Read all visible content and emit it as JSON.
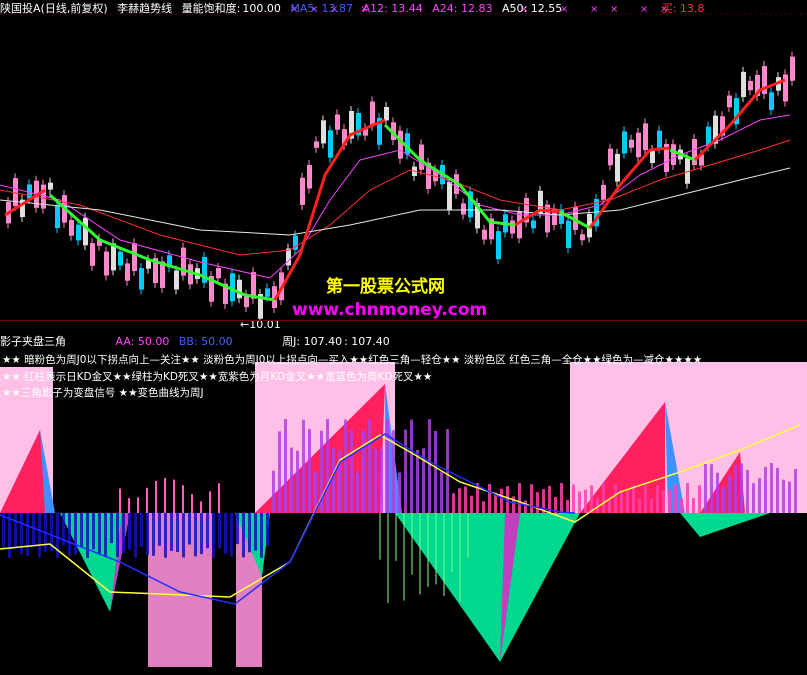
{
  "header1": {
    "stock": "陕国投A",
    "period": "(日线,前复权)",
    "indicator": "李赫趋势线",
    "param_label": "量能饱和度:",
    "param_value": "100.00",
    "ma5": "MA5: 13.87",
    "a12": "A12: 13.44",
    "a24": "A24: 12.83",
    "a50": "A50: 12.55",
    "buy": "买: 13.8"
  },
  "main_chart": {
    "low_marker": "10.01"
  },
  "watermark": {
    "title": "第一股票公式网",
    "url": "www.chnmoney.com"
  },
  "header2": {
    "name": "影子夹盘三角",
    "aa": "AA: 50.00",
    "bb": "BB: 50.00",
    "zhouj": "周J: 107.40",
    "val": ": 107.40"
  },
  "notes": [
    "★★ 暗粉色为周J0以下拐点向上—关注★★ 淡粉色为周J0以上拐点向—买入★★红色三角—轻仓★★ 淡粉色区 红色三角—全仓★★绿色为—减仓★★★★",
    "★★ 红柱表示日KD金叉★★绿柱为KD死叉★★宽紫色为月KD金叉★★宽蓝色为周KD死叉★★",
    "★★三角影子为变盘信号 ★★变色曲线为周J"
  ],
  "colors": {
    "background": "#000000",
    "header_text": "#ffffff",
    "ma5": "#4060ff",
    "a12": "#ff40ff",
    "a24": "#ff40ff",
    "a50": "#ffffff",
    "buy": "#ff3030",
    "watermark_title": "#ffff00",
    "watermark_url": "#ff00ff",
    "up_candle": "#ff88cc",
    "down_candle": "#00ccff",
    "trend_up": "#ff2020",
    "trend_down": "#30ff30",
    "pink_zone": "#ffc0e8",
    "red_triangle": "#ff2060",
    "blue_shadow": "#4090ff",
    "green_triangle": "#00d890",
    "purple_bar": "#b040e0",
    "blue_bar": "#1010c0",
    "yellow_curve": "#ffff40",
    "blue_curve": "#2030ff"
  }
}
